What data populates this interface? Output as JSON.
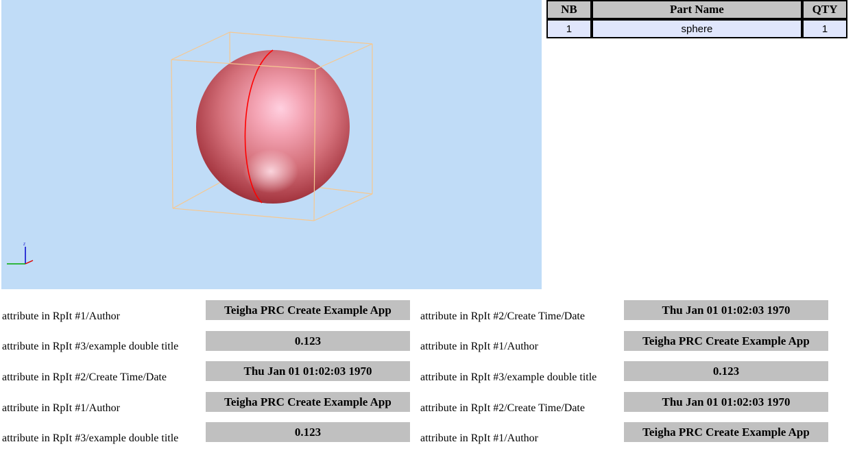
{
  "colors": {
    "viewport_background": "#c0dcf7",
    "bbox_stroke": "#f6c890",
    "sphere_base": "#d4707a",
    "meridian": "#ff0000",
    "table_header_bg": "#c4c4c4",
    "table_cell_bg": "#e0e6fc",
    "value_box_bg": "#c0c0c0"
  },
  "viewer": {
    "axis_label_z": "Z"
  },
  "bom_table": {
    "headers": [
      "NB",
      "Part Name",
      "QTY"
    ],
    "rows": [
      [
        "1",
        "sphere",
        "1"
      ]
    ]
  },
  "attributes": {
    "left": [
      {
        "label": "attribute in RpIt #1/Author",
        "value": "Teigha PRC Create Example App"
      },
      {
        "label": "attribute in RpIt #3/example double title",
        "value": "0.123"
      },
      {
        "label": "attribute in RpIt #2/Create Time/Date",
        "value": "Thu Jan 01 01:02:03 1970"
      },
      {
        "label": "attribute in RpIt #1/Author",
        "value": "Teigha PRC Create Example App"
      },
      {
        "label": "attribute in RpIt #3/example double title",
        "value": "0.123"
      }
    ],
    "right": [
      {
        "label": "attribute in RpIt #2/Create Time/Date",
        "value": "Thu Jan 01 01:02:03 1970"
      },
      {
        "label": "attribute in RpIt #1/Author",
        "value": "Teigha PRC Create Example App"
      },
      {
        "label": "attribute in RpIt #3/example double title",
        "value": "0.123"
      },
      {
        "label": "attribute in RpIt #2/Create Time/Date",
        "value": "Thu Jan 01 01:02:03 1970"
      },
      {
        "label": "attribute in RpIt #1/Author",
        "value": "Teigha PRC Create Example App"
      }
    ]
  }
}
